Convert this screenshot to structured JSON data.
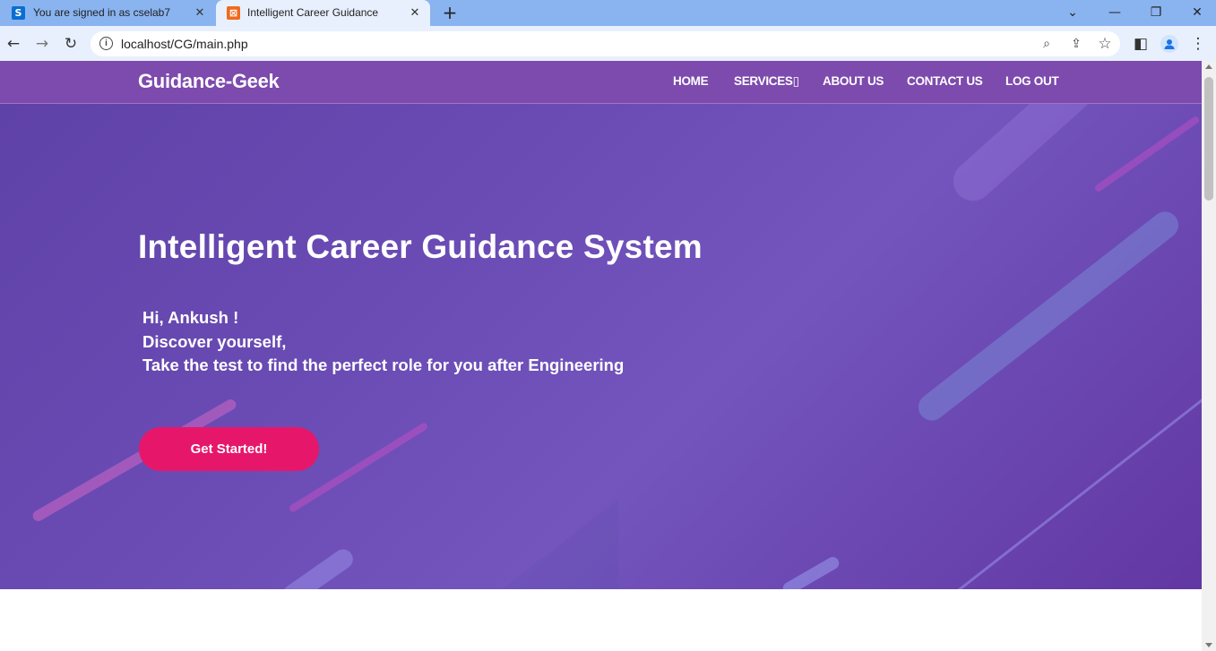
{
  "browser": {
    "tabs": [
      {
        "title": "You are signed in as cselab7",
        "favicon": "S",
        "active": false
      },
      {
        "title": "Intelligent Career Guidance",
        "favicon": "⊠",
        "active": true
      }
    ],
    "close_glyph": "✕",
    "new_tab_glyph": "+",
    "address": "localhost/CG/main.php",
    "icons": {
      "back": "←",
      "forward": "→",
      "reload": "↻",
      "info": "i",
      "zoom": "⌕",
      "share": "⇪",
      "bookmark": "☆",
      "sidepanel": "◧",
      "menu": "⋮",
      "minimize": "—",
      "restore": "❐",
      "close": "✕",
      "tabsearch": "⌄"
    }
  },
  "site": {
    "brand": "Guidance-Geek",
    "menu": [
      "HOME",
      "SERVICES▯",
      "ABOUT US",
      "CONTACT US",
      "LOG OUT"
    ],
    "hero": {
      "title": "Intelligent Career Guidance System",
      "greeting": "Hi, Ankush !",
      "line2": "Discover yourself,",
      "line3": "Take the test to find the perfect role for you after Engineering",
      "cta": "Get Started!"
    },
    "colors": {
      "nav_bg": "#7d4aad",
      "hero_bg": "#6a4bb4",
      "cta_bg": "#e6176b"
    }
  }
}
